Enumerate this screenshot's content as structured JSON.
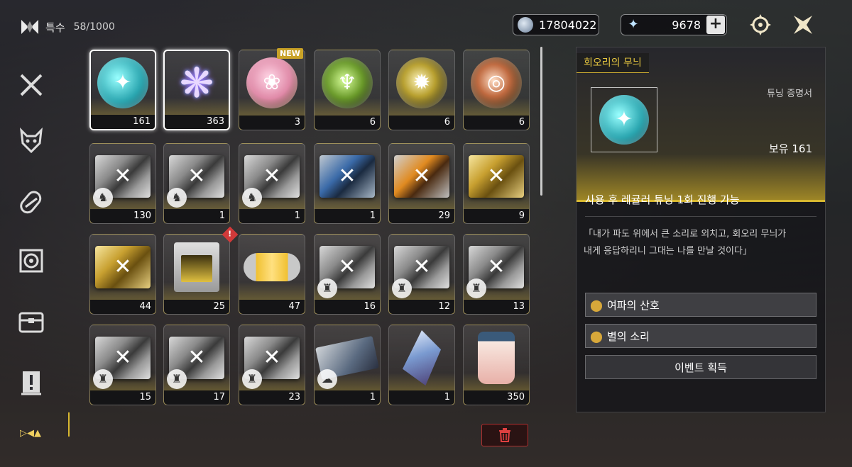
{
  "category": {
    "label": "특수",
    "count": "58/1000"
  },
  "currency": {
    "coins": "17804022",
    "stars": "9678",
    "plus_label": "+"
  },
  "top_buttons": {
    "settings_icon": "gear-icon",
    "close_icon": "close-icon"
  },
  "sidebar": {
    "items": [
      {
        "icon": "crossed-swords-icon"
      },
      {
        "icon": "demon-mask-icon"
      },
      {
        "icon": "capsule-icon"
      },
      {
        "icon": "disc-icon"
      },
      {
        "icon": "chest-icon"
      },
      {
        "icon": "exclamation-icon"
      }
    ]
  },
  "grid": {
    "new_badge": "NEW",
    "alert_badge": "!",
    "rows": [
      [
        {
          "kind": "orb-teal",
          "qty": "161",
          "selected": true
        },
        {
          "kind": "coral",
          "qty": "363",
          "selected": true
        },
        {
          "kind": "orb-pink",
          "qty": "3"
        },
        {
          "kind": "orb-green",
          "qty": "6"
        },
        {
          "kind": "orb-gold",
          "qty": "6"
        },
        {
          "kind": "orb-red",
          "qty": "6"
        }
      ],
      [
        {
          "kind": "box",
          "qty": "130"
        },
        {
          "kind": "box",
          "qty": "1"
        },
        {
          "kind": "box",
          "qty": "1"
        },
        {
          "kind": "box-blue",
          "qty": "1"
        },
        {
          "kind": "box-orange",
          "qty": "29"
        },
        {
          "kind": "box-gold",
          "qty": "9"
        }
      ],
      [
        {
          "kind": "box-gold",
          "qty": "44"
        },
        {
          "kind": "printer",
          "qty": "25"
        },
        {
          "kind": "capsule",
          "qty": "47"
        },
        {
          "kind": "box",
          "qty": "16"
        },
        {
          "kind": "box",
          "qty": "12"
        },
        {
          "kind": "box",
          "qty": "13"
        }
      ],
      [
        {
          "kind": "box",
          "qty": "15"
        },
        {
          "kind": "box",
          "qty": "17"
        },
        {
          "kind": "box",
          "qty": "23"
        },
        {
          "kind": "card",
          "qty": "1"
        },
        {
          "kind": "crystal",
          "qty": "1"
        },
        {
          "kind": "jar",
          "qty": "350"
        }
      ]
    ]
  },
  "panel": {
    "title": "회오리의 무늬",
    "type": "튜닝 증명서",
    "owned": "보유 161",
    "description": "사용 후 레귤러 튜닝 1회 진행 가능",
    "lore_line1": "「내가 파도 위에서 큰 소리로 외치고, 회오리 무늬가",
    "lore_line2": "내게 응답하리니 그대는 나를 만날 것이다」",
    "sources": [
      "여파의 산호",
      "별의 소리"
    ],
    "event_source": "이벤트 획득"
  },
  "trash_icon": "trash-icon"
}
